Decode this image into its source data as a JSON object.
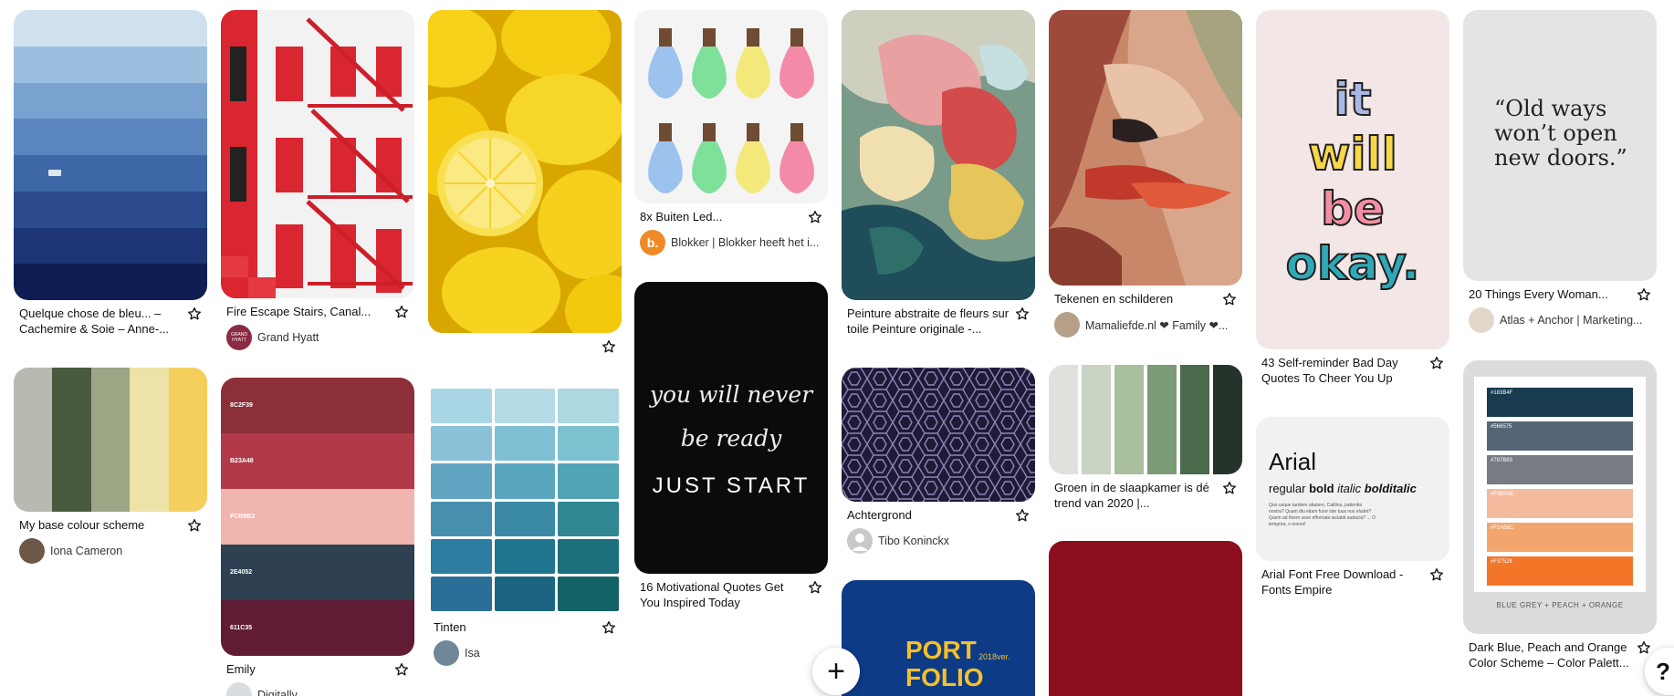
{
  "pins": {
    "p1": {
      "title": "Quelque chose de bleu... – Cachemire & Soie – Anne-..."
    },
    "p2": {
      "title": "Fire Escape Stairs, Canal...",
      "author": "Grand Hyatt",
      "avatar_text": "GRAND HYATT"
    },
    "p4": {
      "title": "8x Buiten Led...",
      "author": "Blokker | Blokker heeft het i...",
      "avatar_text": "b."
    },
    "p5": {
      "title": "Peinture abstraite de fleurs sur toile Peinture originale -..."
    },
    "p6": {
      "title": "Tekenen en schilderen",
      "author": "Mamaliefde.nl ❤ Family ❤..."
    },
    "p7": {
      "title": "43 Self-reminder Bad Day Quotes To Cheer You Up",
      "img_text": [
        "it",
        "will",
        "be",
        "okay."
      ]
    },
    "p8": {
      "title": "20 Things Every Woman...",
      "author": "Atlas + Anchor | Marketing...",
      "img_text": "“Old ways won’t open new doors.”"
    },
    "p9": {
      "title": "My base colour scheme",
      "author": "Iona Cameron"
    },
    "p10": {
      "title": "Emily",
      "author": "Digitally",
      "codes": [
        "8C2F39",
        "B23A48",
        "FCB9B2",
        "2E4052",
        "611C35"
      ]
    },
    "p11": {
      "title": "Tinten",
      "author": "Isa"
    },
    "p12": {
      "title": "16 Motivational Quotes Get You Inspired Today",
      "img_line1": "you will never",
      "img_line2": "be ready",
      "img_line3": "JUST START"
    },
    "p13": {
      "title": "Achtergrond",
      "author": "Tibo Koninckx"
    },
    "p14": {
      "title": "Groen in de slaapkamer is dé trend van 2020 |..."
    },
    "p15": {
      "title": "Arial Font Free Download - Fonts Empire",
      "img_title": "Arial",
      "img_sub1": "regular ",
      "img_sub2": "bold ",
      "img_sub3": "italic ",
      "img_sub4": "bolditalic",
      "img_body": "Quo usque tandem abutere, Catilina, patientia nostra? Quam diu etiam furor iste tuus nos eludet? Quem ad finem sese effrenata iactabit audacia? ... O tempora, o mores!"
    },
    "p16": {
      "title": "Dark Blue, Peach and Orange Color Scheme – Color Palett...",
      "codes": [
        "#183B4F",
        "#566575",
        "#797B83",
        "#F4BA9E",
        "#F2A56C",
        "#F37528"
      ],
      "caption": "BLUE GREY + PEACH + ORANGE"
    },
    "p17": {
      "img_line1": "PORT",
      "img_line2": "FOLIO",
      "img_year": "2018ver."
    }
  },
  "fab_label": "+",
  "help_label": "?",
  "colors": {
    "blue_stripes": [
      "#cfe1ef",
      "#9dbfdf",
      "#7aa2d1",
      "#5c86c0",
      "#3e67a8",
      "#2b4b8e",
      "#1d3575",
      "#101d52"
    ],
    "base_scheme": [
      "#b7bab0",
      "#4a5a3f",
      "#9ca584",
      "#ede2a7",
      "#f4cf5d"
    ],
    "emily": [
      "#8c2f39",
      "#b23a48",
      "#f0b5ae",
      "#2e4052",
      "#611c35"
    ],
    "greens": [
      "#dfe2dc",
      "#c8d3c3",
      "#a9bf9d",
      "#7b9b74",
      "#4a6a4c",
      "#25342b"
    ],
    "tinten": [
      "#a9d6e5",
      "#b4dbe6",
      "#acd8e2",
      "#89c2d9",
      "#7ebfd4",
      "#7cc1d0",
      "#61a5c2",
      "#58a6bd",
      "#4fa3b2",
      "#468faf",
      "#3a8aa6",
      "#2f8793",
      "#2c7da0",
      "#1f7490",
      "#1b6f7d",
      "#2a6f97",
      "#1c6582",
      "#136268"
    ],
    "peach": [
      "#183b4f",
      "#566575",
      "#797b83",
      "#f4ba9e",
      "#f2a56c",
      "#f37528"
    ]
  }
}
